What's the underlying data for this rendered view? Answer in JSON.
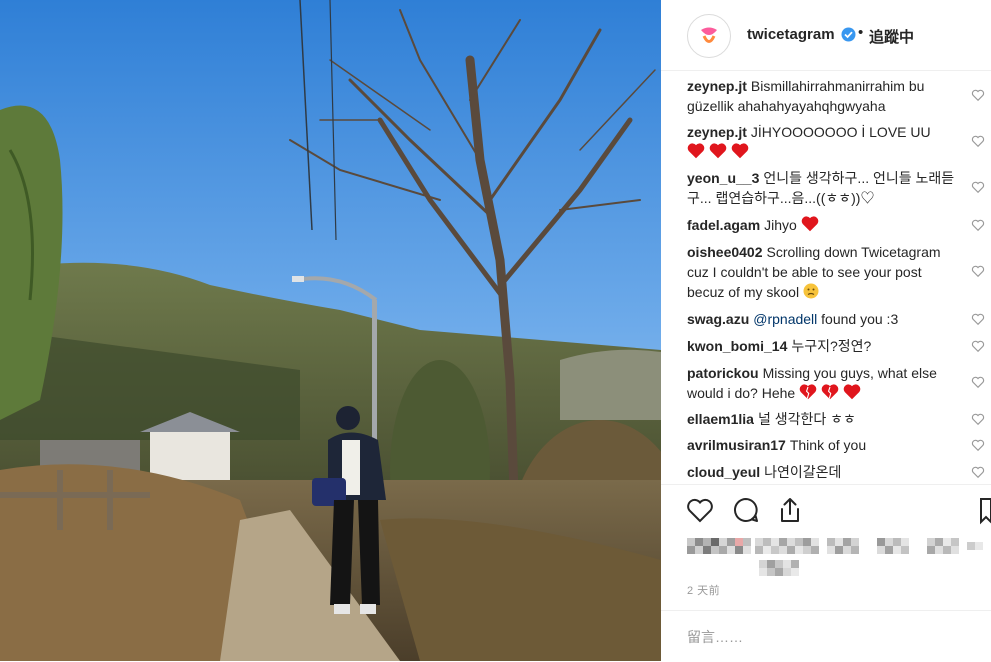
{
  "post": {
    "owner": "twicetagram",
    "follow_status": "追蹤中",
    "separator": "•",
    "timestamp": "2 天前",
    "add_comment_placeholder": "留言……"
  },
  "comments": [
    {
      "user": "zeynep.jt",
      "text": "Bismillahirrahmanirrahim bu güzellik ahahahyayahqhgwyaha"
    },
    {
      "user": "zeynep.jt",
      "text": "JİHYOOOOOOO İ LOVE UU"
    },
    {
      "user": "yeon_u__3",
      "text": "언니들 생각하구... 언니들 노래듣구... 랩연습하구...음...((ㅎㅎ))♡"
    },
    {
      "user": "fadel.agam",
      "text": "Jihyo"
    },
    {
      "user": "oishee0402",
      "text": "Scrolling down Twicetagram cuz I couldn't be able to see your post becuz of my skool"
    },
    {
      "user": "swag.azu",
      "mention": "@rpnadell",
      "text": "found you :3"
    },
    {
      "user": "kwon_bomi_14",
      "text": "누구지?정연?"
    },
    {
      "user": "patorickou",
      "text": "Missing you guys, what else would i do? Hehe"
    },
    {
      "user": "ellaem1lia",
      "text": "널 생각한다 ㅎㅎ"
    },
    {
      "user": "avrilmusiran17",
      "text": "Think of you"
    },
    {
      "user": "cloud_yeul",
      "text": "나연이갈온데"
    }
  ],
  "colors": {
    "sky": "#5b9be0",
    "heart_red": "#e0161d",
    "text": "#262626",
    "muted": "#999999",
    "verified": "#3897f0",
    "brand_pink": "#fc5c9c"
  },
  "icons": {
    "like": "heart-outline-icon",
    "comment": "speech-bubble-icon",
    "share": "share-icon",
    "save": "bookmark-icon"
  }
}
